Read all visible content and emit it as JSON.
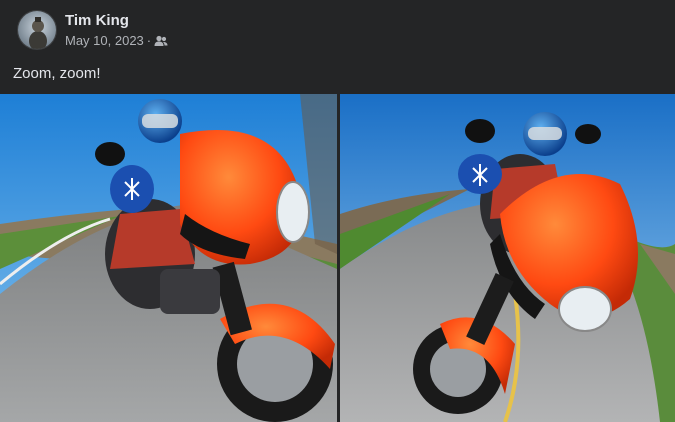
{
  "post": {
    "author": "Tim King",
    "date": "May 10, 2023",
    "separator": "·",
    "audience_icon": "friends-icon",
    "text": "Zoom, zoom!"
  },
  "photos": [
    {
      "name": "photo-motorcycle-left"
    },
    {
      "name": "photo-motorcycle-right"
    }
  ],
  "colors": {
    "background": "#242526",
    "primary_text": "#e4e6eb",
    "secondary_text": "#b0b3b8",
    "bike_orange": "#ff4a12"
  }
}
